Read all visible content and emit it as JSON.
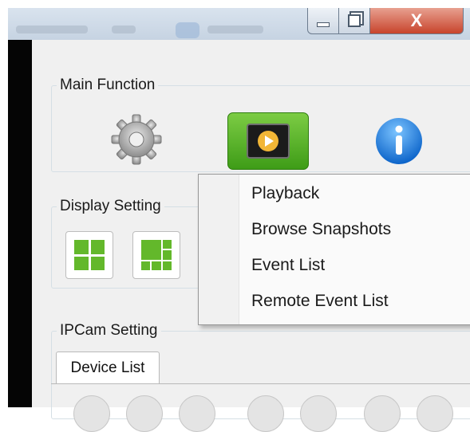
{
  "window": {
    "minimize_label": "",
    "maximize_label": "",
    "close_label": "X"
  },
  "main_function": {
    "title": "Main Function",
    "icons": [
      "gear-icon",
      "playback-icon",
      "info-icon"
    ]
  },
  "display_setting": {
    "title": "Display Setting",
    "layouts": [
      "grid-2x2-icon",
      "grid-1plus5-icon"
    ]
  },
  "ipcam_setting": {
    "title": "IPCam Setting",
    "tabs": [
      {
        "label": "Device List"
      }
    ]
  },
  "context_menu": {
    "items": [
      {
        "label": "Playback"
      },
      {
        "label": "Browse Snapshots"
      },
      {
        "label": "Event List"
      },
      {
        "label": "Remote Event List"
      }
    ]
  },
  "colors": {
    "accent_green": "#63b82b",
    "close_red": "#c8442c",
    "info_blue": "#1e88e5"
  }
}
